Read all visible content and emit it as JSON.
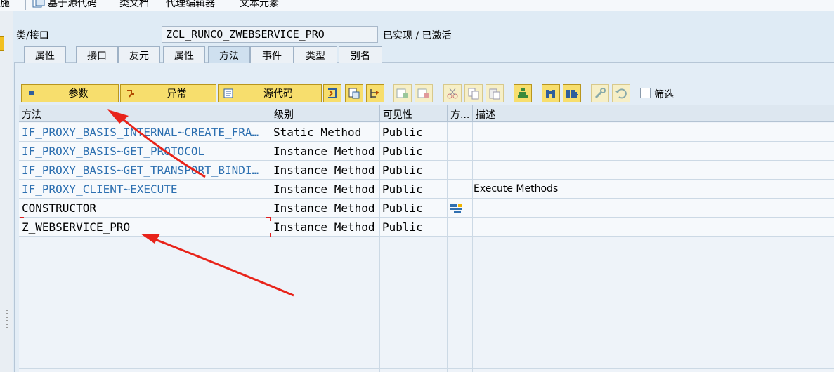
{
  "toolbar": {
    "items": [
      "施",
      "基于源代码",
      "类文档",
      "代理编辑器",
      "文本元素"
    ]
  },
  "header": {
    "class_label": "类/接口",
    "class_name": "ZCL_RUNCO_ZWEBSERVICE_PRO",
    "status": "已实现 / 已激活"
  },
  "tabs": [
    {
      "label": "属性"
    },
    {
      "label": "接口"
    },
    {
      "label": "友元"
    },
    {
      "label": "属性"
    },
    {
      "label": "方法",
      "active": true
    },
    {
      "label": "事件"
    },
    {
      "label": "类型"
    },
    {
      "label": "别名"
    }
  ],
  "method_toolbar": {
    "params_label": "参数",
    "exceptions_label": "异常",
    "source_label": "源代码",
    "filter_label": "筛选",
    "filter_checked": false
  },
  "grid": {
    "columns": [
      "方法",
      "级别",
      "可见性",
      "方...",
      "描述"
    ],
    "rows": [
      {
        "method": "IF_PROXY_BASIS_INTERNAL~CREATE_FRA…",
        "level": "Static Method",
        "visibility": "Public",
        "flag": "",
        "description": "",
        "link": true
      },
      {
        "method": "IF_PROXY_BASIS~GET_PROTOCOL",
        "level": "Instance Method",
        "visibility": "Public",
        "flag": "",
        "description": "",
        "link": true
      },
      {
        "method": "IF_PROXY_BASIS~GET_TRANSPORT_BINDI…",
        "level": "Instance Method",
        "visibility": "Public",
        "flag": "",
        "description": "",
        "link": true
      },
      {
        "method": "IF_PROXY_CLIENT~EXECUTE",
        "level": "Instance Method",
        "visibility": "Public",
        "flag": "",
        "description": "Execute Methods",
        "link": true
      },
      {
        "method": "CONSTRUCTOR",
        "level": "Instance Method",
        "visibility": "Public",
        "flag": "constructor-icon",
        "description": "",
        "link": false
      },
      {
        "method": "Z_WEBSERVICE_PRO",
        "level": "Instance Method",
        "visibility": "Public",
        "flag": "",
        "description": "",
        "link": false,
        "selected": true
      }
    ]
  },
  "colors": {
    "accent_yellow": "#f7de6d",
    "link_blue": "#2c6fb0",
    "annotation_red": "#e8231a"
  }
}
